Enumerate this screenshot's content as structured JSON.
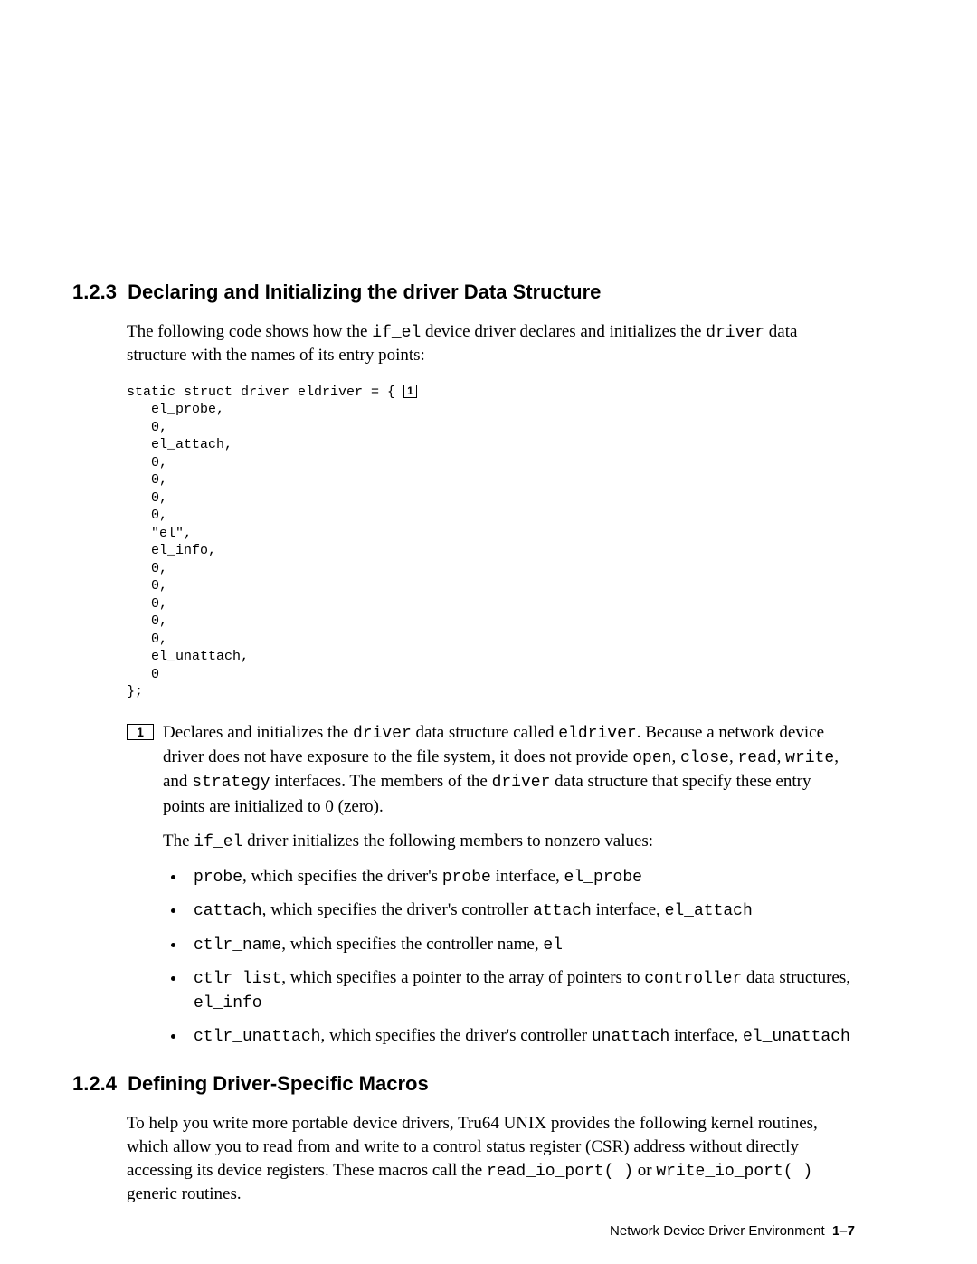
{
  "section_123": {
    "number": "1.2.3",
    "title": "Declaring and Initializing the driver Data Structure",
    "intro_a": "The following code shows how the ",
    "intro_code1": "if_el",
    "intro_b": " device driver declares and initializes the ",
    "intro_code2": "driver",
    "intro_c": " data structure with the names of its entry points:",
    "code_pre": "static struct driver eldriver = { ",
    "code_callout": "1",
    "code_post": "\n   el_probe,\n   0,\n   el_attach,\n   0,\n   0,\n   0,\n   0,\n   \"el\",\n   el_info,\n   0,\n   0,\n   0,\n   0,\n   0,\n   el_unattach,\n   0\n};",
    "note1_num": "1",
    "note1_p1_a": "Declares and initializes the ",
    "note1_p1_code1": "driver",
    "note1_p1_b": " data structure called ",
    "note1_p1_code2": "eldriver",
    "note1_p1_c": ". Because a network device driver does not have exposure to the file system, it does not provide ",
    "note1_p1_code3": "open",
    "note1_p1_d": ", ",
    "note1_p1_code4": "close",
    "note1_p1_e": ", ",
    "note1_p1_code5": "read",
    "note1_p1_f": ", ",
    "note1_p1_code6": "write",
    "note1_p1_g": ", and ",
    "note1_p1_code7": "strategy",
    "note1_p1_h": " interfaces. The members of the ",
    "note1_p1_code8": "driver",
    "note1_p1_i": " data structure that specify these entry points are initialized to 0 (zero).",
    "note1_p2_a": "The ",
    "note1_p2_code1": "if_el",
    "note1_p2_b": " driver initializes the following members to nonzero values:",
    "bullets": {
      "b1_code1": "probe",
      "b1_a": ", which specifies the driver's ",
      "b1_code2": "probe",
      "b1_b": " interface, ",
      "b1_code3": "el_probe",
      "b2_code1": "cattach",
      "b2_a": ", which specifies the driver's controller ",
      "b2_code2": "attach",
      "b2_b": " interface, ",
      "b2_code3": "el_attach",
      "b3_code1": "ctlr_name",
      "b3_a": ", which specifies the controller name, ",
      "b3_code2": "el",
      "b4_code1": "ctlr_list",
      "b4_a": ", which specifies a pointer to the array of pointers to ",
      "b4_code2": "controller",
      "b4_b": " data structures, ",
      "b4_code3": "el_info",
      "b5_code1": "ctlr_unattach",
      "b5_a": ", which specifies the driver's controller ",
      "b5_code2": "unattach",
      "b5_b": " interface, ",
      "b5_code3": "el_unattach"
    }
  },
  "section_124": {
    "number": "1.2.4",
    "title": "Defining Driver-Specific Macros",
    "intro_a": "To help you write more portable device drivers, Tru64 UNIX provides the following kernel routines, which allow you to read from and write to a control status register (CSR) address without directly accessing its device registers. These macros call the ",
    "intro_code1": "read_io_port( )",
    "intro_b": " or ",
    "intro_code2": "write_io_port( )",
    "intro_c": " generic routines."
  },
  "footer": {
    "title": "Network Device Driver Environment",
    "page": "1–7"
  }
}
